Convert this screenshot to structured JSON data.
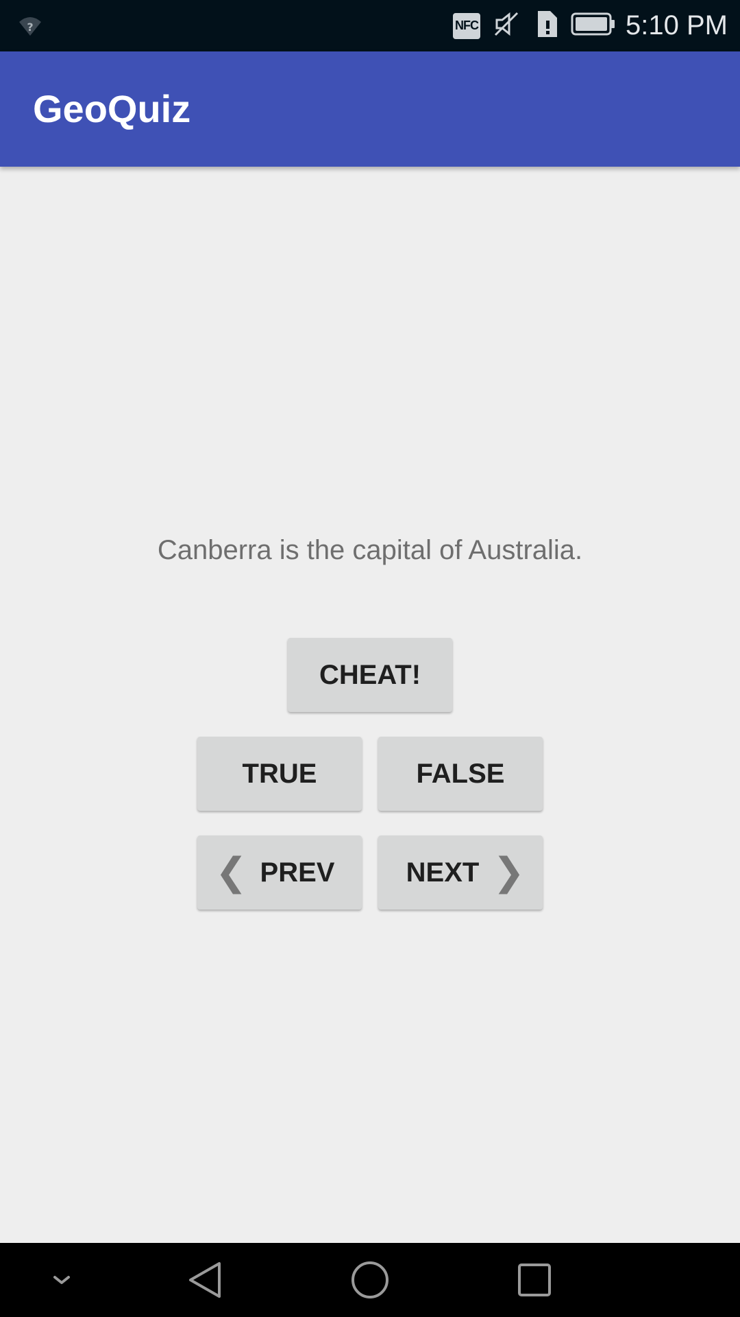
{
  "status_bar": {
    "time": "5:10 PM",
    "nfc_label": "NFC",
    "icons": [
      "wifi-unknown-icon",
      "nfc-icon",
      "mute-icon",
      "sim-alert-icon",
      "battery-icon"
    ]
  },
  "app_bar": {
    "title": "GeoQuiz",
    "color": "#3f51b5"
  },
  "quiz": {
    "question": "Canberra is the capital of Australia.",
    "cheat_label": "CHEAT!",
    "true_label": "TRUE",
    "false_label": "FALSE",
    "prev_label": "PREV",
    "next_label": "NEXT",
    "prev_chevron": "❮",
    "next_chevron": "❯"
  },
  "nav_bar": {
    "icons": [
      "chevron-down-icon",
      "back-icon",
      "home-icon",
      "recents-icon"
    ]
  }
}
